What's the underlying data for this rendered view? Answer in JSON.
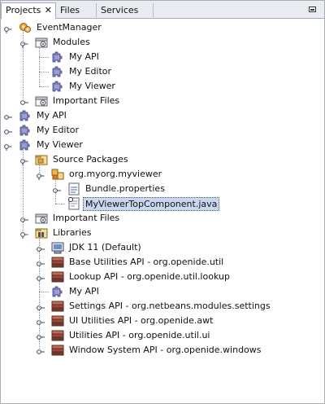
{
  "tabs": [
    {
      "label": "Projects",
      "active": true
    },
    {
      "label": "Files",
      "active": false
    },
    {
      "label": "Services",
      "active": false
    }
  ],
  "tree": [
    {
      "depth": 0,
      "label": "EventManager",
      "icon": "suite-icon",
      "toggle": "expanded"
    },
    {
      "depth": 1,
      "label": "Modules",
      "icon": "modules-folder-icon",
      "toggle": "expanded"
    },
    {
      "depth": 2,
      "label": "My API",
      "icon": "module-icon",
      "toggle": "none"
    },
    {
      "depth": 2,
      "label": "My Editor",
      "icon": "module-icon",
      "toggle": "none"
    },
    {
      "depth": 2,
      "label": "My Viewer",
      "icon": "module-icon",
      "toggle": "none"
    },
    {
      "depth": 1,
      "label": "Important Files",
      "icon": "important-files-icon",
      "toggle": "collapsed"
    },
    {
      "depth": 0,
      "label": "My API",
      "icon": "module-icon",
      "toggle": "collapsed"
    },
    {
      "depth": 0,
      "label": "My Editor",
      "icon": "module-icon",
      "toggle": "collapsed"
    },
    {
      "depth": 0,
      "label": "My Viewer",
      "icon": "module-icon",
      "toggle": "expanded"
    },
    {
      "depth": 1,
      "label": "Source Packages",
      "icon": "source-packages-icon",
      "toggle": "expanded"
    },
    {
      "depth": 2,
      "label": "org.myorg.myviewer",
      "icon": "package-icon",
      "toggle": "expanded"
    },
    {
      "depth": 3,
      "label": "Bundle.properties",
      "icon": "properties-file-icon",
      "toggle": "collapsed"
    },
    {
      "depth": 3,
      "label": "MyViewerTopComponent.java",
      "icon": "java-file-icon",
      "toggle": "none",
      "selected": true
    },
    {
      "depth": 1,
      "label": "Important Files",
      "icon": "important-files-icon",
      "toggle": "collapsed"
    },
    {
      "depth": 1,
      "label": "Libraries",
      "icon": "libraries-icon",
      "toggle": "expanded"
    },
    {
      "depth": 2,
      "label": "JDK 11 (Default)",
      "icon": "jdk-icon",
      "toggle": "collapsed"
    },
    {
      "depth": 2,
      "label": "Base Utilities API - org.openide.util",
      "icon": "library-jar-icon",
      "toggle": "collapsed"
    },
    {
      "depth": 2,
      "label": "Lookup API - org.openide.util.lookup",
      "icon": "library-jar-icon",
      "toggle": "collapsed"
    },
    {
      "depth": 2,
      "label": "My API",
      "icon": "module-icon",
      "toggle": "none"
    },
    {
      "depth": 2,
      "label": "Settings API - org.netbeans.modules.settings",
      "icon": "library-jar-icon",
      "toggle": "collapsed"
    },
    {
      "depth": 2,
      "label": "UI Utilities API - org.openide.awt",
      "icon": "library-jar-icon",
      "toggle": "collapsed"
    },
    {
      "depth": 2,
      "label": "Utilities API - org.openide.util.ui",
      "icon": "library-jar-icon",
      "toggle": "collapsed"
    },
    {
      "depth": 2,
      "label": "Window System API - org.openide.windows",
      "icon": "library-jar-icon",
      "toggle": "collapsed"
    }
  ]
}
